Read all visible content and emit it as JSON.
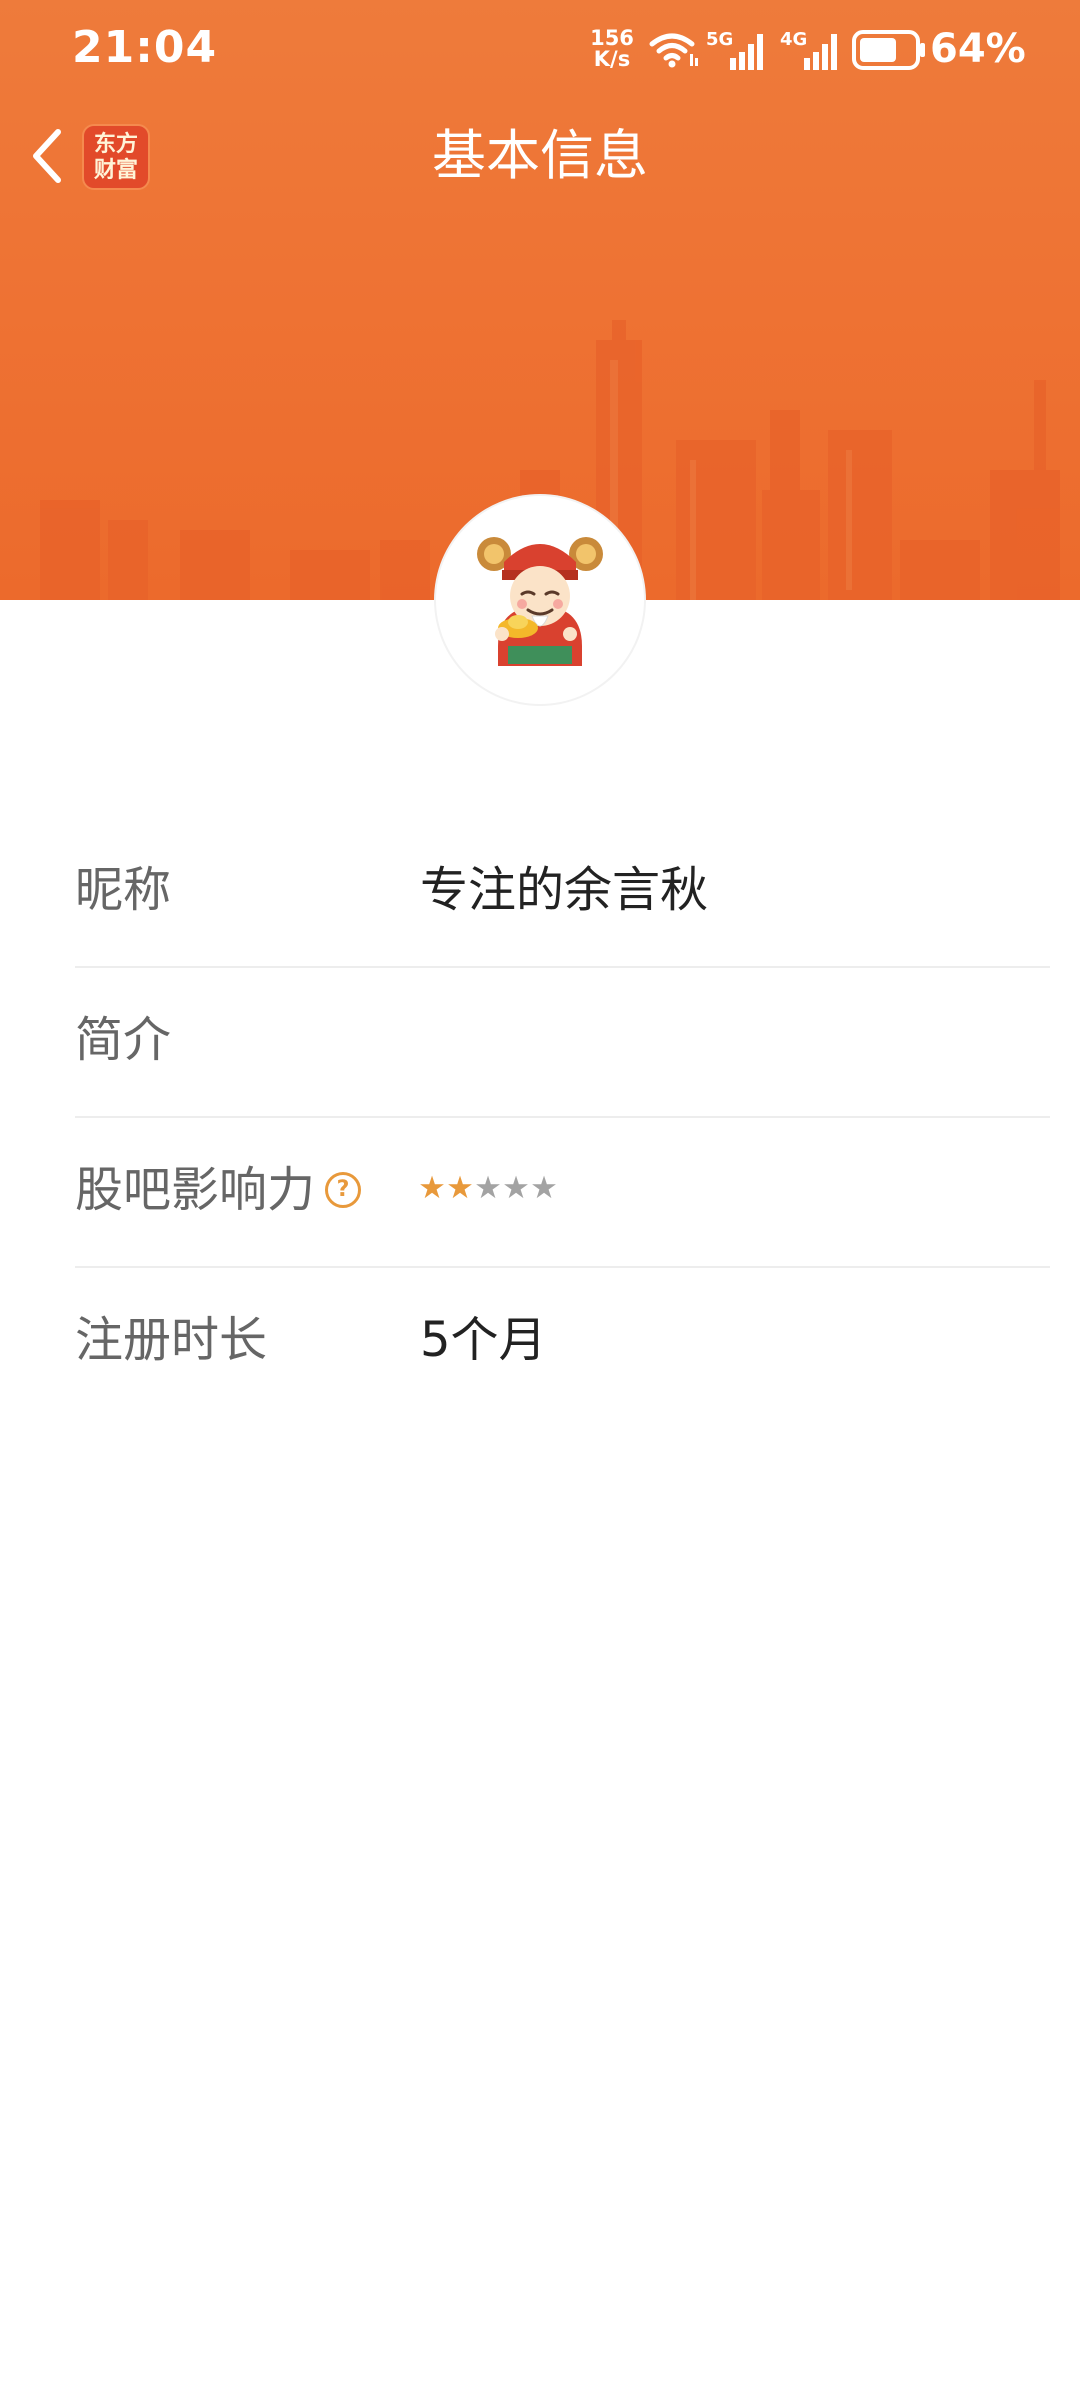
{
  "status_bar": {
    "time": "21:04",
    "net_speed_value": "156",
    "net_speed_unit": "K/s",
    "network_5g": "5G",
    "network_4g": "4G",
    "battery_percent": "64%",
    "battery_level": 0.64
  },
  "nav": {
    "back_icon": "chevron-left-icon",
    "logo_line1": "东方",
    "logo_line2": "财富",
    "title": "基本信息"
  },
  "avatar": {
    "icon": "god-of-wealth-avatar"
  },
  "profile": {
    "nickname_label": "昵称",
    "nickname_value": "专注的余言秋",
    "intro_label": "简介",
    "intro_value": "",
    "influence_label": "股吧影响力",
    "influence_help_icon": "?",
    "influence_stars_filled": 2,
    "influence_stars_total": 5,
    "registration_label": "注册时长",
    "registration_value": "5个月"
  },
  "colors": {
    "brand_orange": "#ee7334",
    "star_active": "#e8993b",
    "star_inactive": "#a3a3a3",
    "label_text": "#666666",
    "value_text": "#222222",
    "divider": "#ededed"
  }
}
